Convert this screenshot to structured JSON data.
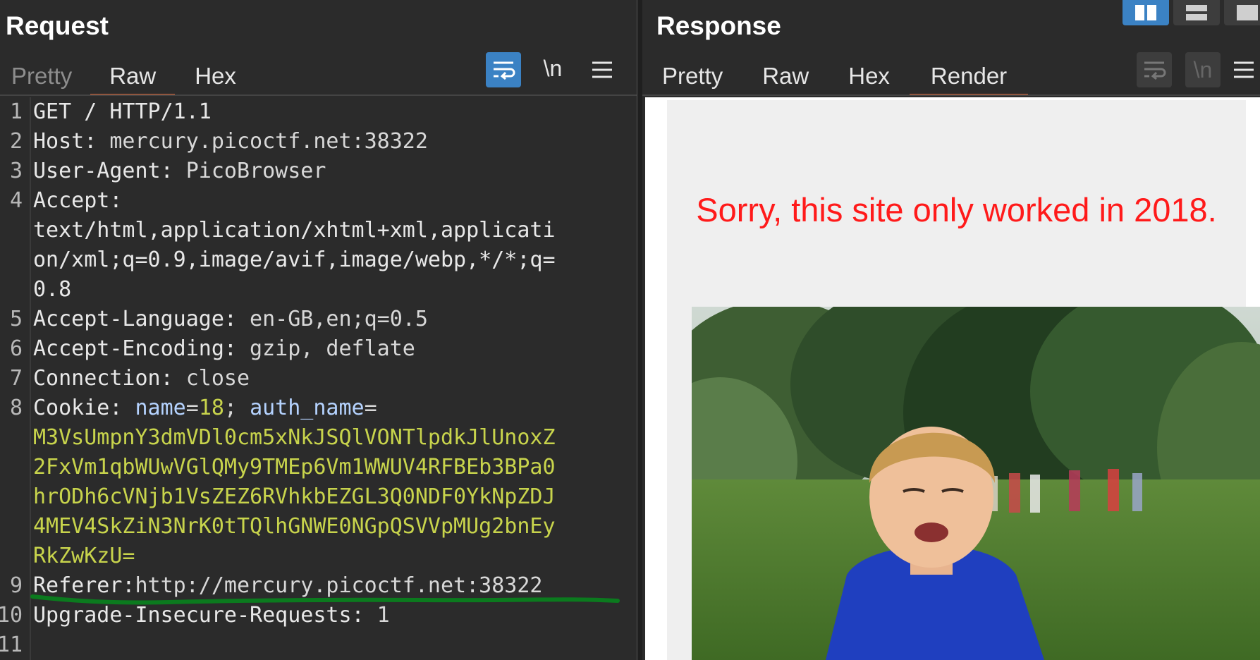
{
  "request": {
    "title": "Request",
    "tabs": [
      "Pretty",
      "Raw",
      "Hex"
    ],
    "active_tab": "Raw",
    "toolbar": {
      "wrap_icon": "wrap-lines-icon",
      "newline_label": "\\n",
      "menu_icon": "hamburger-icon"
    },
    "lines": [
      {
        "num": "1",
        "text": "GET / HTTP/1.1"
      },
      {
        "num": "2",
        "name": "Host:",
        "value": " mercury.picoctf.net:38322"
      },
      {
        "num": "3",
        "name": "User-Agent:",
        "value": " PicoBrowser"
      },
      {
        "num": "4",
        "name": "Accept:",
        "value": ""
      },
      {
        "num": "",
        "text": "text/html,application/xhtml+xml,applicati"
      },
      {
        "num": "",
        "text": "on/xml;q=0.9,image/avif,image/webp,*/*;q="
      },
      {
        "num": "",
        "text": "0.8"
      },
      {
        "num": "5",
        "name": "Accept-Language:",
        "value": " en-GB,en;q=0.5"
      },
      {
        "num": "6",
        "name": "Accept-Encoding:",
        "value": " gzip, deflate"
      },
      {
        "num": "7",
        "name": "Connection:",
        "value": " close"
      },
      {
        "num": "8",
        "cookie": true,
        "name": "Cookie:",
        "c1": " name",
        "c2": "=",
        "c3": "18",
        "c4": "; ",
        "c5": "auth_name",
        "c6": "="
      },
      {
        "num": "",
        "cv": "M3VsUmpnY3dmVDl0cm5xNkJSQlVONTlpdkJlUnoxZ"
      },
      {
        "num": "",
        "cv": "2FxVm1qbWUwVGlQMy9TMEp6Vm1WWUV4RFBEb3BPa0"
      },
      {
        "num": "",
        "cv": "hrODh6cVNjb1VsZEZ6RVhkbEZGL3Q0NDF0YkNpZDJ"
      },
      {
        "num": "",
        "cv": "4MEV4SkZiN3NrK0tTQlhGNWE0NGpQSVVpMUg2bnEy"
      },
      {
        "num": "",
        "cv": "RkZwKzU="
      },
      {
        "num": "9",
        "name": "Referer:",
        "value": "http://mercury.picoctf.net:38322"
      },
      {
        "num": "10",
        "name": "Upgrade-Insecure-Requests:",
        "value": " 1"
      },
      {
        "num": "11",
        "text": ""
      }
    ]
  },
  "response": {
    "title": "Response",
    "tabs": [
      "Pretty",
      "Raw",
      "Hex",
      "Render"
    ],
    "active_tab": "Render",
    "toolbar": {
      "wrap_icon": "wrap-lines-icon",
      "newline_label": "\\n",
      "menu_icon": "hamburger-icon"
    },
    "render": {
      "message": "Sorry, this site only worked in 2018.",
      "message_color": "#ff1a1a",
      "image_icon": "boy-in-park-image"
    }
  },
  "colors": {
    "accent_tab": "#e0693a",
    "active_button": "#3b82c4",
    "cookie_value": "#c8d44c",
    "annotation_underline": "#0b7a1e"
  }
}
